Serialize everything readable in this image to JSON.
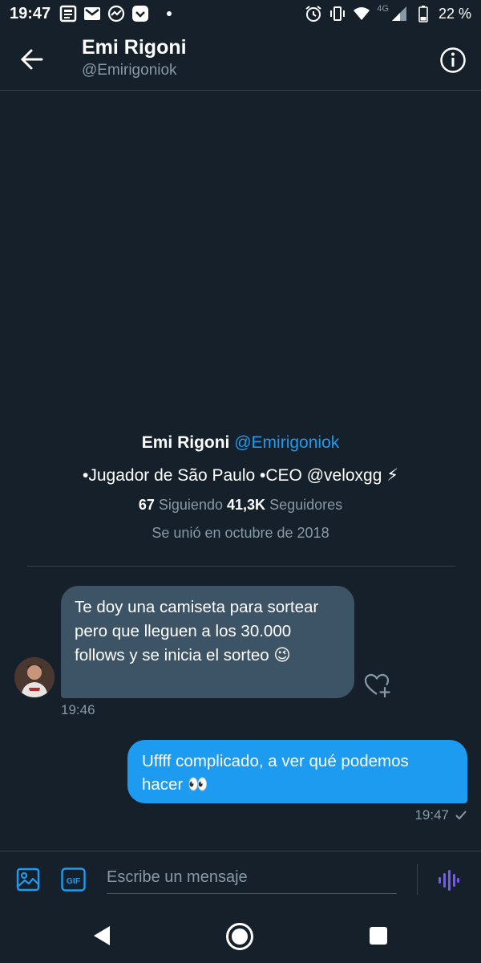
{
  "status_bar": {
    "time": "19:47",
    "network": "4G",
    "battery": "22 %"
  },
  "header": {
    "name": "Emi Rigoni",
    "handle": "@Emirigoniok"
  },
  "profile": {
    "name": "Emi Rigoni",
    "handle": "@Emirigoniok",
    "bio": "•Jugador de São Paulo •CEO @veloxgg ⚡",
    "following_count": "67",
    "following_label": "Siguiendo",
    "followers_count": "41,3K",
    "followers_label": "Seguidores",
    "joined": "Se unió en octubre de 2018"
  },
  "messages": [
    {
      "direction": "incoming",
      "text": "Te doy una camiseta para sortear pero que lleguen a los 30.000 follows y se inicia el sorteo 😉",
      "time": "19:46"
    },
    {
      "direction": "outgoing",
      "text": "Uffff complicado, a ver qué podemos hacer 👀",
      "time": "19:47"
    }
  ],
  "composer": {
    "placeholder": "Escribe un mensaje",
    "gif_label": "GIF"
  },
  "colors": {
    "background": "#15202b",
    "accent": "#1d9bf0",
    "incoming_bubble": "#3d5466",
    "muted_text": "#8899a6",
    "voice_icon": "#7856ff"
  }
}
